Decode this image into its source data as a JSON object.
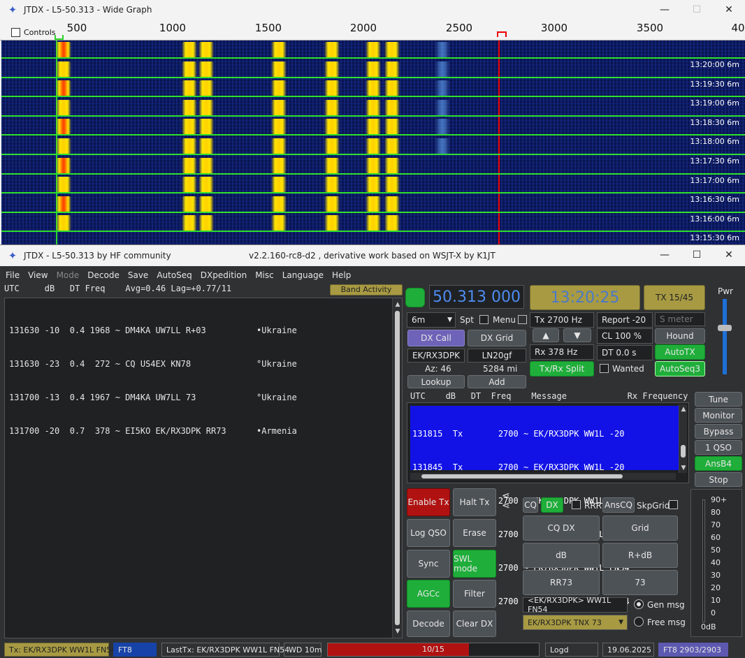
{
  "widegraph": {
    "title": "JTDX - L5-50.313 - Wide Graph",
    "controls_label": "Controls",
    "scale_ticks": [
      "500",
      "1000",
      "1500",
      "2000",
      "2500",
      "3000",
      "3500",
      "40"
    ],
    "rows": [
      {
        "time": "13:20:00",
        "band": "6m"
      },
      {
        "time": "13:19:30",
        "band": "6m"
      },
      {
        "time": "13:19:00",
        "band": "6m"
      },
      {
        "time": "13:18:30",
        "band": "6m"
      },
      {
        "time": "13:18:00",
        "band": "6m"
      },
      {
        "time": "13:17:30",
        "band": "6m"
      },
      {
        "time": "13:17:00",
        "band": "6m"
      },
      {
        "time": "13:16:30",
        "band": "6m"
      },
      {
        "time": "13:16:00",
        "band": "6m"
      },
      {
        "time": "13:15:30",
        "band": "6m"
      }
    ]
  },
  "main": {
    "title": "JTDX - L5-50.313  by HF community",
    "version": "v2.2.160-rc8-d2 , derivative work based on WSJT-X by K1JT",
    "menu": [
      "File",
      "View",
      "Mode",
      "Decode",
      "Save",
      "AutoSeq",
      "DXpedition",
      "Misc",
      "Language",
      "Help"
    ]
  },
  "band_activity": {
    "header": "UTC     dB   DT Freq    Avg=0.46 Lag=+0.77/11",
    "button": "Band Activity",
    "rows": [
      "131630 -10  0.4 1968 ~ DM4KA UW7LL R+03          •Ukraine",
      "131630 -23  0.4  272 ~ CQ US4EX KN78             °Ukraine",
      "131700 -13  0.4 1967 ~ DM4KA UW7LL 73            °Ukraine",
      "131700 -20  0.7  378 ~ EI5KO EK/RX3DPK RR73      •Armenia"
    ]
  },
  "controls": {
    "frequency": "50.313 000",
    "clock": "13:20:25",
    "tx_period": "TX 15/45",
    "pwr_label": "Pwr",
    "band": "6m",
    "spt": "Spt",
    "menu": "Menu",
    "tx_freq": "Tx  2700  Hz",
    "report": "Report -20",
    "smeter_placeholder": "S meter",
    "up": "▲",
    "down": "▼",
    "cl": "CL  100 %",
    "hound": "Hound",
    "dx_call_btn": "DX Call",
    "dx_grid_btn": "DX Grid",
    "dx_call": "EK/RX3DPK",
    "dx_grid": "LN20gf",
    "rx_freq": "Rx  378  Hz",
    "dt": "DT  0.0 s",
    "autotx": "AutoTX",
    "az": "Az: 46",
    "dist": "5284 mi",
    "txrx_split": "Tx/Rx Split",
    "wanted": "Wanted",
    "autoseq3": "AutoSeq3",
    "lookup": "Lookup",
    "add": "Add"
  },
  "tx_list": {
    "header": "UTC    dB   DT  Freq    Message            Rx Frequency",
    "rows": [
      "131815  Tx       2700 ~ EK/RX3DPK WW1L -20",
      "131845  Tx       2700 ~ EK/RX3DPK WW1L -20",
      "131848  Tx       2700 ~ EK/RX3DPK WW1L FN54",
      "131915  Tx       2700 ~ EK/RX3DPK WW1L FN54",
      "131945  Tx       2700 ~ EK/RX3DPK WW1L FN54",
      "132015  Tx       2700 ~ EK/RX3DPK WW1L FN54"
    ]
  },
  "side_buttons": [
    "Tune",
    "Monitor",
    "Bypass",
    "1 QSO",
    "AnsB4",
    "Stop"
  ],
  "left_buttons": {
    "enable_tx": "Enable Tx",
    "halt_tx": "Halt Tx",
    "log_qso": "Log QSO",
    "erase": "Erase",
    "sync": "Sync",
    "swl_mode": "SWL mode",
    "agcc": "AGCc",
    "filter": "Filter",
    "decode": "Decode",
    "clear_dx": "Clear DX"
  },
  "msg_panel": {
    "cq": "CQ",
    "dx": "DX",
    "rrr": "RRR",
    "anscq": "AnsCQ",
    "skpgrid": "SkpGrid",
    "cq_dx": "CQ DX",
    "grid": "Grid",
    "db": "dB",
    "r_db": "R+dB",
    "rr73": "RR73",
    "b73": "73",
    "gen_msg_text": "<EK/RX3DPK> WW1L FN54",
    "gen_msg": "Gen msg",
    "free_msg_text": "EK/RX3DPK TNX 73",
    "free_msg": "Free msg"
  },
  "meter": {
    "scale": [
      "90+",
      "80",
      "70",
      "60",
      "50",
      "40",
      "30",
      "20",
      "10",
      "0"
    ],
    "unit": "0dB"
  },
  "status": {
    "tx_msg": "Tx: EK/RX3DPK WW1L FN54",
    "mode": "FT8",
    "last_tx": "LastTx: EK/RX3DPK WW1L FN54",
    "wd": "WD 10m",
    "progress_text": "10/15",
    "progress": 0.67,
    "logd": "Logd",
    "date": "19.06.2025",
    "decodes": "FT8   2903/2903"
  }
}
